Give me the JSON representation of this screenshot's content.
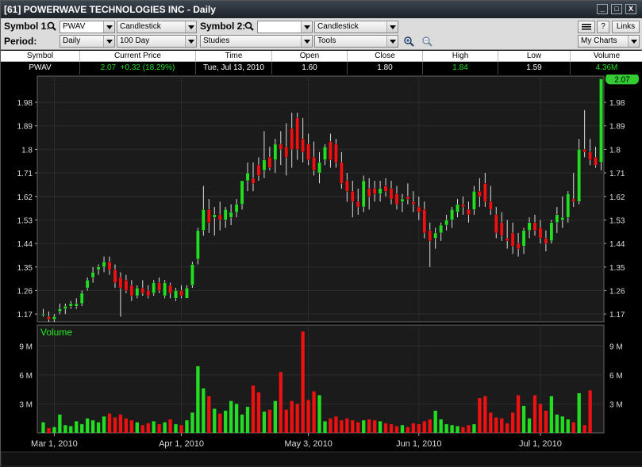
{
  "window": {
    "title": "[61] POWERWAVE TECHNOLOGIES INC - Daily",
    "controls": [
      "_",
      "□",
      "X"
    ]
  },
  "toolbar": {
    "symbol1_label": "Symbol 1:",
    "symbol1_value": "PWAV",
    "chart_type1": "Candlestick",
    "symbol2_label": "Symbol 2:",
    "symbol2_value": "",
    "chart_type2": "Candlestick",
    "period_label": "Period:",
    "period_value": "Daily",
    "range_value": "100 Day",
    "studies_label": "Studies",
    "tools_label": "Tools",
    "help_label": "?",
    "links_label": "Links",
    "mycharts_label": "My Charts"
  },
  "quote": {
    "headers": [
      "Symbol",
      "Current Price",
      "Time",
      "Open",
      "Close",
      "High",
      "Low",
      "Volume"
    ],
    "symbol": "PWAV",
    "current_price": "2.07",
    "change": "+0.32 (18.29%)",
    "time": "Tue, Jul 13, 2010",
    "open": "1.60",
    "close": "1.80",
    "high": "1.84",
    "low": "1.59",
    "volume": "4.36M"
  },
  "colors": {
    "up": "#22dd22",
    "down": "#ee1111",
    "price_tag": "#33cc33",
    "volume_label": "#22ee22"
  },
  "chart_data": [
    {
      "type": "candlestick",
      "price_ticks": [
        "1.98",
        "1.89",
        "1.8",
        "1.71",
        "1.62",
        "1.53",
        "1.44",
        "1.35",
        "1.26",
        "1.17"
      ],
      "ylim": [
        1.14,
        2.05
      ],
      "last_price": "2.07",
      "x_labels": [
        "Mar 1, 2010",
        "Apr 1, 2010",
        "May 3, 2010",
        "Jun 1, 2010",
        "Jul 1, 2010"
      ],
      "x_label_index": [
        2,
        25,
        48,
        68,
        90
      ],
      "ohlc": [
        [
          1.17,
          1.19,
          1.16,
          1.17
        ],
        [
          1.16,
          1.18,
          1.14,
          1.15
        ],
        [
          1.15,
          1.17,
          1.14,
          1.16
        ],
        [
          1.18,
          1.21,
          1.17,
          1.19
        ],
        [
          1.19,
          1.21,
          1.17,
          1.2
        ],
        [
          1.2,
          1.22,
          1.19,
          1.21
        ],
        [
          1.2,
          1.23,
          1.19,
          1.21
        ],
        [
          1.21,
          1.26,
          1.2,
          1.25
        ],
        [
          1.27,
          1.31,
          1.26,
          1.3
        ],
        [
          1.31,
          1.35,
          1.29,
          1.33
        ],
        [
          1.34,
          1.36,
          1.32,
          1.35
        ],
        [
          1.35,
          1.39,
          1.33,
          1.37
        ],
        [
          1.37,
          1.39,
          1.32,
          1.34
        ],
        [
          1.34,
          1.36,
          1.27,
          1.29
        ],
        [
          1.31,
          1.33,
          1.16,
          1.27
        ],
        [
          1.3,
          1.32,
          1.25,
          1.26
        ],
        [
          1.28,
          1.3,
          1.22,
          1.24
        ],
        [
          1.24,
          1.28,
          1.23,
          1.27
        ],
        [
          1.27,
          1.3,
          1.24,
          1.25
        ],
        [
          1.26,
          1.28,
          1.23,
          1.24
        ],
        [
          1.25,
          1.3,
          1.24,
          1.29
        ],
        [
          1.29,
          1.31,
          1.25,
          1.26
        ],
        [
          1.24,
          1.3,
          1.23,
          1.29
        ],
        [
          1.28,
          1.29,
          1.23,
          1.25
        ],
        [
          1.23,
          1.27,
          1.22,
          1.26
        ],
        [
          1.26,
          1.28,
          1.23,
          1.24
        ],
        [
          1.23,
          1.28,
          1.23,
          1.27
        ],
        [
          1.28,
          1.37,
          1.27,
          1.36
        ],
        [
          1.38,
          1.5,
          1.36,
          1.49
        ],
        [
          1.49,
          1.66,
          1.47,
          1.57
        ],
        [
          1.57,
          1.61,
          1.48,
          1.52
        ],
        [
          1.54,
          1.58,
          1.47,
          1.55
        ],
        [
          1.55,
          1.6,
          1.49,
          1.53
        ],
        [
          1.53,
          1.58,
          1.5,
          1.57
        ],
        [
          1.54,
          1.59,
          1.51,
          1.56
        ],
        [
          1.56,
          1.61,
          1.54,
          1.59
        ],
        [
          1.59,
          1.68,
          1.57,
          1.68
        ],
        [
          1.68,
          1.75,
          1.64,
          1.71
        ],
        [
          1.69,
          1.75,
          1.64,
          1.67
        ],
        [
          1.74,
          1.77,
          1.68,
          1.7
        ],
        [
          1.72,
          1.87,
          1.69,
          1.76
        ],
        [
          1.77,
          1.81,
          1.72,
          1.73
        ],
        [
          1.76,
          1.84,
          1.71,
          1.82
        ],
        [
          1.82,
          1.87,
          1.74,
          1.8
        ],
        [
          1.81,
          1.9,
          1.7,
          1.77
        ],
        [
          1.88,
          1.94,
          1.73,
          1.8
        ],
        [
          1.92,
          1.94,
          1.76,
          1.8
        ],
        [
          1.84,
          1.92,
          1.75,
          1.79
        ],
        [
          1.82,
          1.86,
          1.74,
          1.76
        ],
        [
          1.77,
          1.83,
          1.7,
          1.72
        ],
        [
          1.71,
          1.79,
          1.67,
          1.75
        ],
        [
          1.76,
          1.82,
          1.74,
          1.81
        ],
        [
          1.83,
          1.86,
          1.73,
          1.76
        ],
        [
          1.82,
          1.84,
          1.73,
          1.75
        ],
        [
          1.75,
          1.79,
          1.65,
          1.67
        ],
        [
          1.68,
          1.71,
          1.6,
          1.64
        ],
        [
          1.64,
          1.68,
          1.54,
          1.6
        ],
        [
          1.6,
          1.65,
          1.55,
          1.58
        ],
        [
          1.58,
          1.7,
          1.56,
          1.68
        ],
        [
          1.65,
          1.69,
          1.57,
          1.62
        ],
        [
          1.65,
          1.68,
          1.6,
          1.63
        ],
        [
          1.63,
          1.68,
          1.6,
          1.65
        ],
        [
          1.66,
          1.69,
          1.62,
          1.64
        ],
        [
          1.65,
          1.68,
          1.59,
          1.61
        ],
        [
          1.63,
          1.66,
          1.57,
          1.59
        ],
        [
          1.6,
          1.63,
          1.56,
          1.61
        ],
        [
          1.62,
          1.67,
          1.59,
          1.61
        ],
        [
          1.6,
          1.64,
          1.56,
          1.59
        ],
        [
          1.58,
          1.62,
          1.53,
          1.56
        ],
        [
          1.57,
          1.6,
          1.46,
          1.48
        ],
        [
          1.49,
          1.52,
          1.35,
          1.45
        ],
        [
          1.46,
          1.5,
          1.42,
          1.48
        ],
        [
          1.48,
          1.52,
          1.45,
          1.51
        ],
        [
          1.51,
          1.55,
          1.49,
          1.53
        ],
        [
          1.53,
          1.58,
          1.5,
          1.57
        ],
        [
          1.56,
          1.61,
          1.54,
          1.59
        ],
        [
          1.59,
          1.62,
          1.55,
          1.58
        ],
        [
          1.57,
          1.6,
          1.52,
          1.55
        ],
        [
          1.57,
          1.66,
          1.55,
          1.64
        ],
        [
          1.64,
          1.69,
          1.58,
          1.62
        ],
        [
          1.67,
          1.71,
          1.58,
          1.6
        ],
        [
          1.6,
          1.66,
          1.55,
          1.57
        ],
        [
          1.55,
          1.58,
          1.46,
          1.48
        ],
        [
          1.52,
          1.56,
          1.45,
          1.47
        ],
        [
          1.46,
          1.53,
          1.42,
          1.45
        ],
        [
          1.48,
          1.52,
          1.4,
          1.43
        ],
        [
          1.44,
          1.48,
          1.39,
          1.42
        ],
        [
          1.43,
          1.5,
          1.4,
          1.49
        ],
        [
          1.49,
          1.54,
          1.46,
          1.52
        ],
        [
          1.52,
          1.55,
          1.47,
          1.49
        ],
        [
          1.5,
          1.53,
          1.44,
          1.46
        ],
        [
          1.46,
          1.49,
          1.41,
          1.44
        ],
        [
          1.45,
          1.53,
          1.44,
          1.52
        ],
        [
          1.52,
          1.58,
          1.48,
          1.55
        ],
        [
          1.53,
          1.62,
          1.5,
          1.54
        ],
        [
          1.54,
          1.64,
          1.52,
          1.63
        ],
        [
          1.61,
          1.71,
          1.58,
          1.6
        ],
        [
          1.6,
          1.84,
          1.59,
          1.8
        ],
        [
          1.8,
          1.95,
          1.77,
          1.79
        ],
        [
          1.79,
          1.84,
          1.74,
          1.76
        ],
        [
          1.77,
          1.81,
          1.73,
          1.74
        ],
        [
          1.75,
          2.07,
          1.72,
          2.07
        ]
      ]
    },
    {
      "type": "bar",
      "title": "Volume",
      "unit": "M",
      "y_ticks": [
        "9 M",
        "6 M",
        "3 M"
      ],
      "ylim": [
        0,
        10.5
      ],
      "values": [
        1.1,
        0.5,
        0.6,
        1.9,
        0.8,
        0.7,
        1.2,
        0.9,
        1.5,
        1.3,
        1.1,
        1.7,
        2.0,
        1.6,
        1.9,
        1.5,
        1.3,
        1.1,
        0.8,
        1.0,
        1.2,
        0.9,
        1.1,
        1.4,
        0.9,
        0.8,
        1.3,
        2.1,
        6.9,
        4.6,
        3.8,
        2.5,
        2.0,
        2.3,
        3.3,
        3.0,
        1.9,
        2.7,
        4.9,
        4.2,
        2.2,
        2.4,
        3.3,
        6.3,
        2.4,
        3.3,
        3.0,
        10.5,
        3.4,
        4.3,
        3.9,
        1.2,
        1.5,
        1.7,
        1.3,
        1.5,
        1.3,
        1.1,
        1.3,
        1.4,
        1.3,
        1.2,
        1.0,
        0.9,
        0.7,
        0.8,
        0.6,
        1.0,
        0.9,
        1.2,
        1.4,
        2.3,
        1.4,
        0.9,
        0.8,
        0.7,
        0.6,
        0.8,
        0.9,
        3.6,
        3.8,
        2.1,
        1.6,
        1.5,
        1.0,
        2.1,
        3.9,
        2.8,
        1.5,
        3.9,
        3.0,
        2.3,
        3.8,
        1.9,
        1.7,
        1.4,
        1.1,
        4.1,
        0.8,
        4.4
      ]
    }
  ]
}
